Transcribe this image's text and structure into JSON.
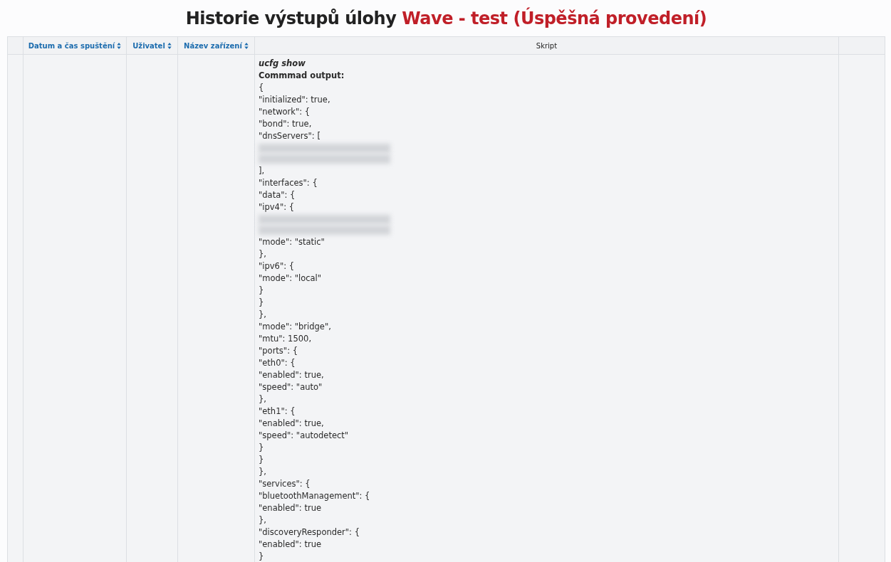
{
  "title": {
    "text": "Historie výstupů úlohy",
    "highlight": "Wave - test (Úspěšná provedení)"
  },
  "table": {
    "columns": [
      {
        "label": "Datum a čas spuštění",
        "sortable": true
      },
      {
        "label": "Uživatel",
        "sortable": true
      },
      {
        "label": "Název zařízení",
        "sortable": true
      },
      {
        "label": "Skript",
        "sortable": false
      }
    ],
    "rows": [
      {
        "script": {
          "command": "ucfg show",
          "output_label": "Commmad output:",
          "lines": [
            {
              "kind": "text",
              "text": "{"
            },
            {
              "kind": "text",
              "text": "\"initialized\": true,"
            },
            {
              "kind": "text",
              "text": "\"network\": {"
            },
            {
              "kind": "text",
              "text": "\"bond\": true,"
            },
            {
              "kind": "text",
              "text": "\"dnsServers\": ["
            },
            {
              "kind": "redacted"
            },
            {
              "kind": "redacted"
            },
            {
              "kind": "text",
              "text": "],"
            },
            {
              "kind": "text",
              "text": "\"interfaces\": {"
            },
            {
              "kind": "text",
              "text": "\"data\": {"
            },
            {
              "kind": "text",
              "text": "\"ipv4\": {"
            },
            {
              "kind": "redacted"
            },
            {
              "kind": "redacted"
            },
            {
              "kind": "text",
              "text": "\"mode\": \"static\""
            },
            {
              "kind": "text",
              "text": "},"
            },
            {
              "kind": "text",
              "text": "\"ipv6\": {"
            },
            {
              "kind": "text",
              "text": "\"mode\": \"local\""
            },
            {
              "kind": "text",
              "text": "}"
            },
            {
              "kind": "text",
              "text": "}"
            },
            {
              "kind": "text",
              "text": "},"
            },
            {
              "kind": "text",
              "text": "\"mode\": \"bridge\","
            },
            {
              "kind": "text",
              "text": "\"mtu\": 1500,"
            },
            {
              "kind": "text",
              "text": "\"ports\": {"
            },
            {
              "kind": "text",
              "text": "\"eth0\": {"
            },
            {
              "kind": "text",
              "text": "\"enabled\": true,"
            },
            {
              "kind": "text",
              "text": "\"speed\": \"auto\""
            },
            {
              "kind": "text",
              "text": "},"
            },
            {
              "kind": "text",
              "text": "\"eth1\": {"
            },
            {
              "kind": "text",
              "text": "\"enabled\": true,"
            },
            {
              "kind": "text",
              "text": "\"speed\": \"autodetect\""
            },
            {
              "kind": "text",
              "text": "}"
            },
            {
              "kind": "text",
              "text": "}"
            },
            {
              "kind": "text",
              "text": "},"
            },
            {
              "kind": "text",
              "text": "\"services\": {"
            },
            {
              "kind": "text",
              "text": "\"bluetoothManagement\": {"
            },
            {
              "kind": "text",
              "text": "\"enabled\": true"
            },
            {
              "kind": "text",
              "text": "},"
            },
            {
              "kind": "text",
              "text": "\"discoveryResponder\": {"
            },
            {
              "kind": "text",
              "text": "\"enabled\": true"
            },
            {
              "kind": "text",
              "text": "}"
            }
          ]
        }
      }
    ]
  }
}
